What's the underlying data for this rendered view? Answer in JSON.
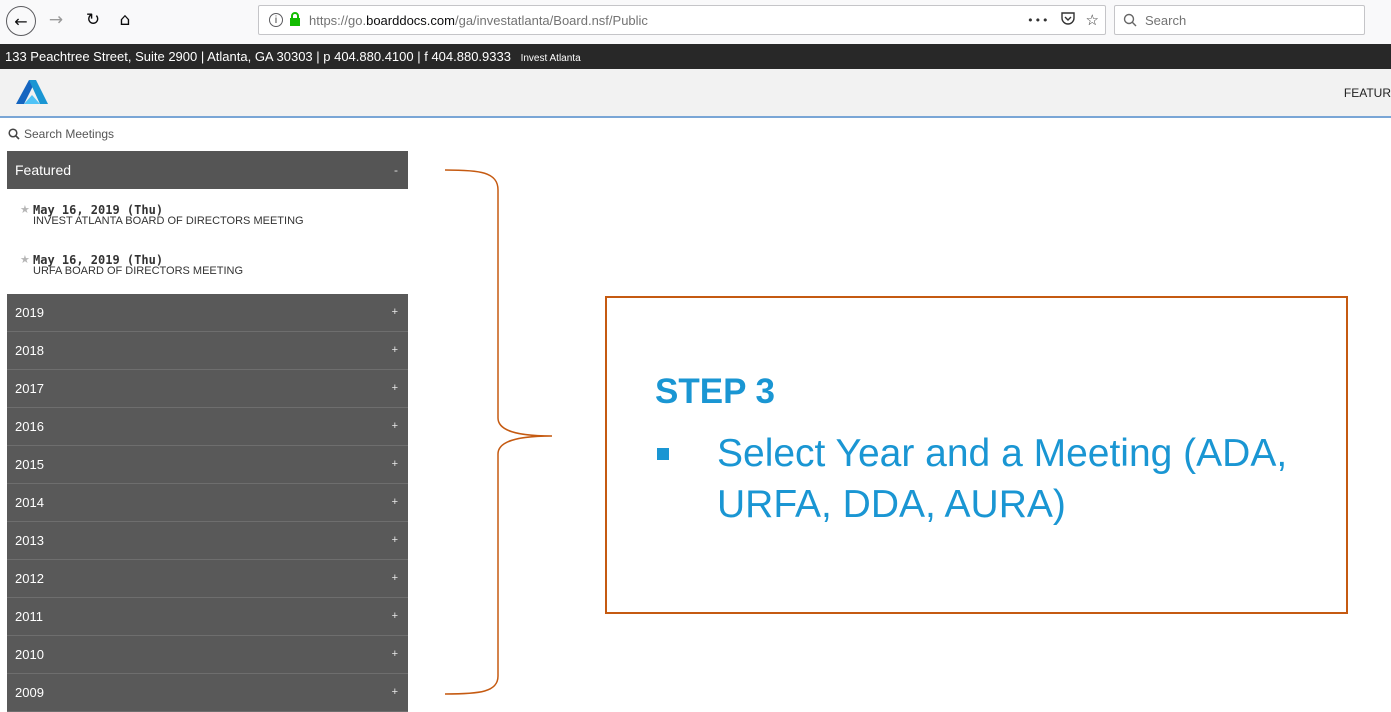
{
  "browser": {
    "url_prefix": "https://go.",
    "url_domain": "boarddocs.com",
    "url_path": "/ga/investatlanta/Board.nsf/Public",
    "more_label": "•••",
    "search_placeholder": "Search"
  },
  "site": {
    "address_line": "133 Peachtree Street, Suite 2900 | Atlanta, GA 30303 | p 404.880.4100 | f 404.880.9333",
    "brand_label": "Invest Atlanta",
    "nav_featured": "FEATUR",
    "accent_color": "#1a96d3"
  },
  "sidebar": {
    "search_label": "Search Meetings",
    "featured": {
      "label": "Featured",
      "toggle": "-",
      "meetings": [
        {
          "date": "May 16, 2019 (Thu)",
          "title": "INVEST ATLANTA BOARD OF DIRECTORS MEETING"
        },
        {
          "date": "May 16, 2019 (Thu)",
          "title": "URFA BOARD OF DIRECTORS MEETING"
        }
      ]
    },
    "years": [
      {
        "label": "2019",
        "toggle": "+"
      },
      {
        "label": "2018",
        "toggle": "+"
      },
      {
        "label": "2017",
        "toggle": "+"
      },
      {
        "label": "2016",
        "toggle": "+"
      },
      {
        "label": "2015",
        "toggle": "+"
      },
      {
        "label": "2014",
        "toggle": "+"
      },
      {
        "label": "2013",
        "toggle": "+"
      },
      {
        "label": "2012",
        "toggle": "+"
      },
      {
        "label": "2011",
        "toggle": "+"
      },
      {
        "label": "2010",
        "toggle": "+"
      },
      {
        "label": "2009",
        "toggle": "+"
      }
    ]
  },
  "callout": {
    "title": "STEP 3",
    "text": "Select Year and a Meeting (ADA, URFA, DDA, AURA)",
    "border_color": "#c55a11"
  }
}
